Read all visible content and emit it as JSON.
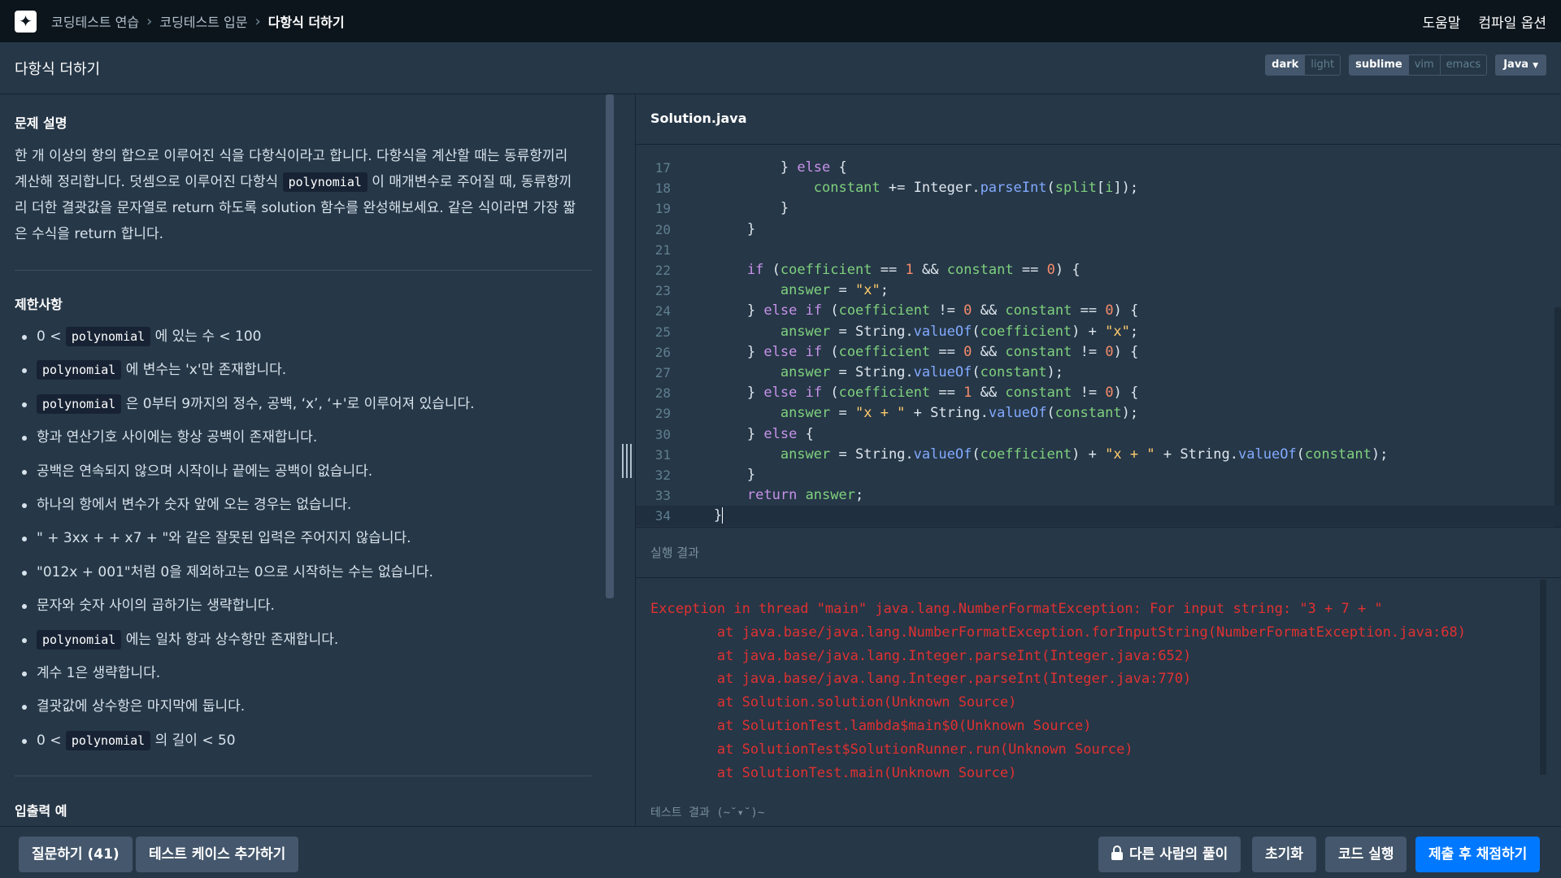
{
  "nav": {
    "crumbs": [
      "코딩테스트 연습",
      "코딩테스트 입문"
    ],
    "current": "다항식 더하기",
    "help": "도움말",
    "compile_options": "컴파일 옵션"
  },
  "title": "다항식 더하기",
  "settings": {
    "themes": [
      "dark",
      "light"
    ],
    "keymaps": [
      "sublime",
      "vim",
      "emacs"
    ],
    "language": "Java"
  },
  "problem": {
    "desc_title": "문제 설명",
    "desc_parts": [
      "한 개 이상의 항의 합으로 이루어진 식을 다항식이라고 합니다. 다항식을 계산할 때는 동류항끼리",
      "계산해 정리합니다. 덧셈으로 이루어진 다항식 ",
      "polynomial",
      " 이 매개변수로 주어질 때, 동류항끼",
      "리 더한 결괏값을 문자열로 return 하도록 solution 함수를 완성해보세요. 같은 식이라면 가장 짧",
      "은 수식을 return 합니다."
    ],
    "constraints_title": "제한사항",
    "constraints": [
      {
        "pre": "0 < ",
        "code": "polynomial",
        "post": " 에 있는 수 < 100"
      },
      {
        "pre": "",
        "code": "polynomial",
        "post": " 에 변수는 'x'만 존재합니다."
      },
      {
        "pre": "",
        "code": "polynomial",
        "post": " 은 0부터 9까지의 정수, 공백, ‘x’, ‘+'로 이루어져 있습니다."
      },
      {
        "pre": "항과 연산기호 사이에는 항상 공백이 존재합니다.",
        "code": "",
        "post": ""
      },
      {
        "pre": "공백은 연속되지 않으며 시작이나 끝에는 공백이 없습니다.",
        "code": "",
        "post": ""
      },
      {
        "pre": "하나의 항에서 변수가 숫자 앞에 오는 경우는 없습니다.",
        "code": "",
        "post": ""
      },
      {
        "pre": "\" + 3xx + + x7 + \"와 같은 잘못된 입력은 주어지지 않습니다.",
        "code": "",
        "post": ""
      },
      {
        "pre": "\"012x + 001\"처럼 0을 제외하고는 0으로 시작하는 수는 없습니다.",
        "code": "",
        "post": ""
      },
      {
        "pre": "문자와 숫자 사이의 곱하기는 생략합니다.",
        "code": "",
        "post": ""
      },
      {
        "pre": "",
        "code": "polynomial",
        "post": " 에는 일차 항과 상수항만 존재합니다."
      },
      {
        "pre": "계수 1은 생략합니다.",
        "code": "",
        "post": ""
      },
      {
        "pre": "결괏값에 상수항은 마지막에 둡니다.",
        "code": "",
        "post": ""
      },
      {
        "pre": "0 < ",
        "code": "polynomial",
        "post": " 의 길이 < 50"
      }
    ],
    "io_title": "입출력 예"
  },
  "editor": {
    "filename": "Solution.java",
    "lines": [
      {
        "n": "17",
        "t": "            } else {"
      },
      {
        "n": "18",
        "t": "                constant += Integer.parseInt(split[i]);"
      },
      {
        "n": "19",
        "t": "            }"
      },
      {
        "n": "20",
        "t": "        }"
      },
      {
        "n": "21",
        "t": ""
      },
      {
        "n": "22",
        "t": "        if (coefficient == 1 && constant == 0) {"
      },
      {
        "n": "23",
        "t": "            answer = \"x\";"
      },
      {
        "n": "24",
        "t": "        } else if (coefficient != 0 && constant == 0) {"
      },
      {
        "n": "25",
        "t": "            answer = String.valueOf(coefficient) + \"x\";"
      },
      {
        "n": "26",
        "t": "        } else if (coefficient == 0 && constant != 0) {"
      },
      {
        "n": "27",
        "t": "            answer = String.valueOf(constant);"
      },
      {
        "n": "28",
        "t": "        } else if (coefficient == 1 && constant != 0) {"
      },
      {
        "n": "29",
        "t": "            answer = \"x + \" + String.valueOf(constant);"
      },
      {
        "n": "30",
        "t": "        } else {"
      },
      {
        "n": "31",
        "t": "            answer = String.valueOf(coefficient) + \"x + \" + String.valueOf(constant);"
      },
      {
        "n": "32",
        "t": "        }"
      },
      {
        "n": "33",
        "t": "        return answer;"
      },
      {
        "n": "34",
        "t": "    }"
      }
    ]
  },
  "output": {
    "title": "실행 결과",
    "lines": [
      "Exception in thread \"main\" java.lang.NumberFormatException: For input string: \"3 + 7 + \"",
      "\tat java.base/java.lang.NumberFormatException.forInputString(NumberFormatException.java:68)",
      "\tat java.base/java.lang.Integer.parseInt(Integer.java:652)",
      "\tat java.base/java.lang.Integer.parseInt(Integer.java:770)",
      "\tat Solution.solution(Unknown Source)",
      "\tat SolutionTest.lambda$main$0(Unknown Source)",
      "\tat SolutionTest$SolutionRunner.run(Unknown Source)",
      "\tat SolutionTest.main(Unknown Source)"
    ],
    "test_result": "테스트 결과 (~˘▾˘)~"
  },
  "buttons": {
    "ask": "질문하기 (41)",
    "add_testcase": "테스트 케이스 추가하기",
    "others_solution": "다른 사람의 풀이",
    "reset": "초기화",
    "run": "코드 실행",
    "submit": "제출 후 채점하기"
  }
}
